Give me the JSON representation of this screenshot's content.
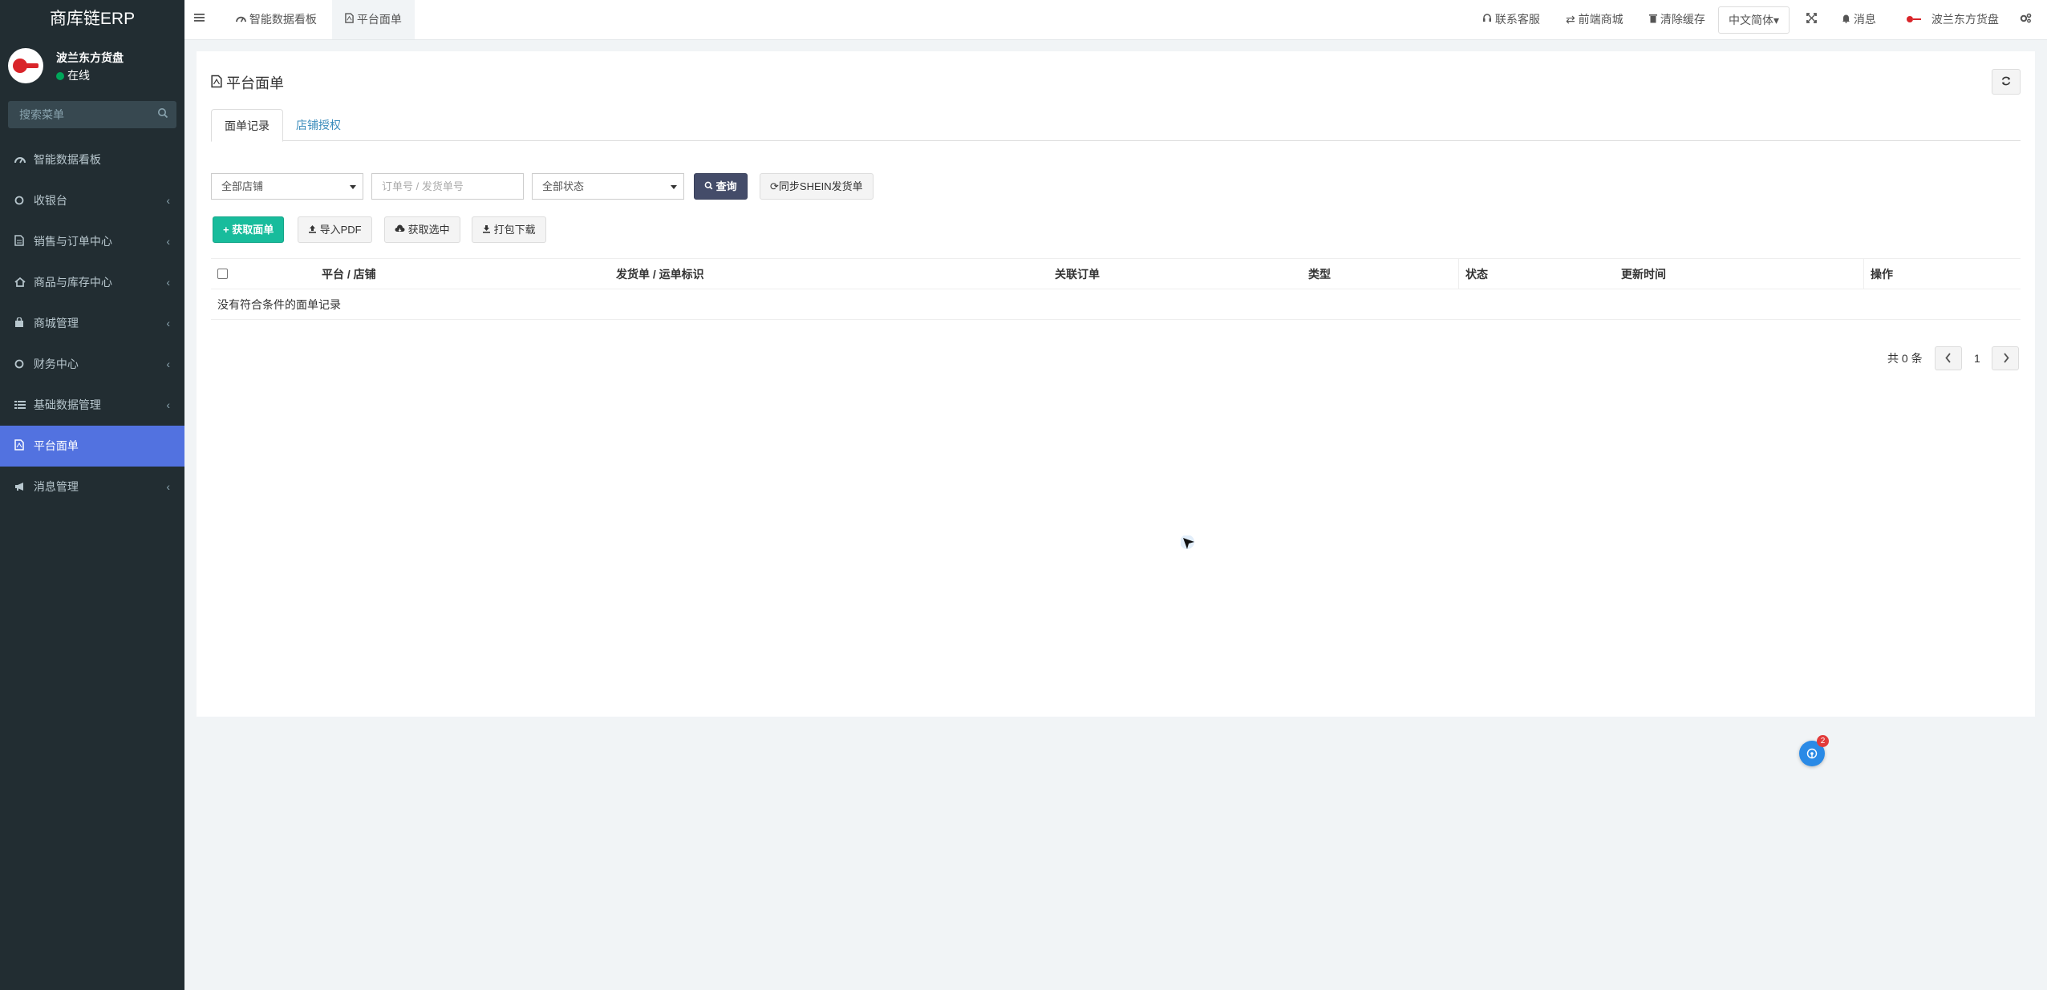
{
  "sidebar": {
    "brand": "商库链ERP",
    "user": {
      "name": "波兰东方货盘",
      "status": "在线"
    },
    "search_placeholder": "搜索菜单",
    "items": [
      {
        "label": "智能数据看板",
        "icon": "dashboard-icon",
        "has_children": false
      },
      {
        "label": "收银台",
        "icon": "circle-icon",
        "has_children": true
      },
      {
        "label": "销售与订单中心",
        "icon": "document-icon",
        "has_children": true
      },
      {
        "label": "商品与库存中心",
        "icon": "home-icon",
        "has_children": true
      },
      {
        "label": "商城管理",
        "icon": "shopping-bag-icon",
        "has_children": true
      },
      {
        "label": "财务中心",
        "icon": "circle-icon",
        "has_children": true
      },
      {
        "label": "基础数据管理",
        "icon": "list-icon",
        "has_children": true
      },
      {
        "label": "平台面单",
        "icon": "pdf-file-icon",
        "has_children": false,
        "active": true
      },
      {
        "label": "消息管理",
        "icon": "bullhorn-icon",
        "has_children": true
      }
    ]
  },
  "navbar": {
    "tabs": [
      {
        "label": "智能数据看板",
        "icon": "dashboard-icon"
      },
      {
        "label": "平台面单",
        "icon": "pdf-file-icon",
        "active": true
      }
    ],
    "right": {
      "support": "联系客服",
      "frontend": "前端商城",
      "clear_cache": "清除缓存",
      "language": "中文简体",
      "messages": "消息",
      "user": "波兰东方货盘"
    }
  },
  "main": {
    "title": "平台面单",
    "tabs": [
      {
        "label": "面单记录",
        "active": true
      },
      {
        "label": "店铺授权",
        "active": false
      }
    ],
    "filters": {
      "shop_select": "全部店铺",
      "order_placeholder": "订单号 / 发货单号",
      "status_select": "全部状态",
      "query_button": "查询",
      "sync_button": "同步SHEIN发货单"
    },
    "actions": {
      "fetch": "获取面单",
      "import_pdf": "导入PDF",
      "fetch_selected": "获取选中",
      "pack_download": "打包下载"
    },
    "table": {
      "columns": [
        "平台 / 店铺",
        "发货单 / 运单标识",
        "关联订单",
        "类型",
        "状态",
        "更新时间",
        "操作"
      ],
      "empty_text": "没有符合条件的面单记录"
    },
    "pagination": {
      "total": "共 0 条",
      "page": "1"
    }
  },
  "float_badge": {
    "count": "2"
  },
  "colors": {
    "sidebar_bg": "#222d32",
    "active_menu": "#5272e0",
    "success": "#18bc9c",
    "dark_button": "#444c69"
  }
}
